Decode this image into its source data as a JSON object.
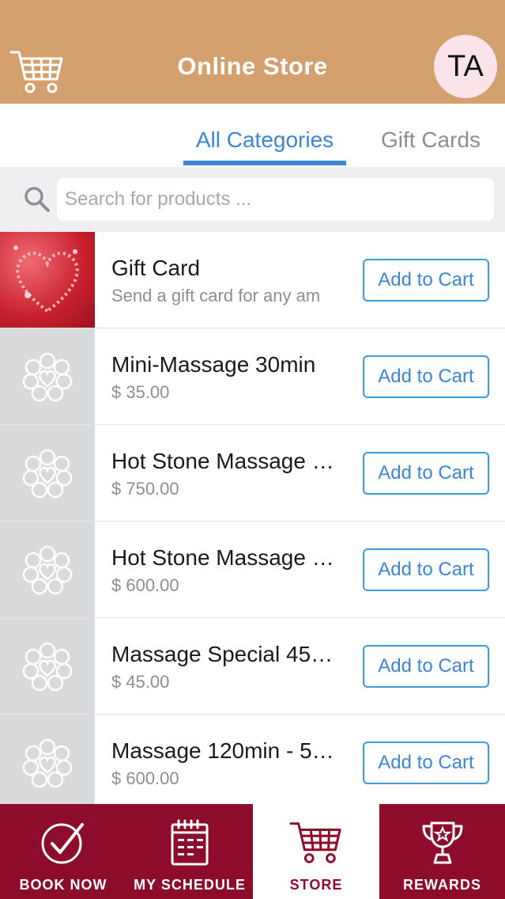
{
  "header": {
    "title": "Online Store",
    "avatar_initials": "TA",
    "left_icon": "cart-icon"
  },
  "tabs": [
    {
      "label": "All Categories",
      "active": true
    },
    {
      "label": "Gift Cards",
      "active": false
    }
  ],
  "search": {
    "placeholder": "Search for products ...",
    "value": ""
  },
  "products": [
    {
      "title": "Gift Card",
      "subtitle": "Send a gift card for any am",
      "button": "Add to Cart",
      "image": "gift-card-heart-image"
    },
    {
      "title": "Mini-Massage 30min",
      "subtitle": "$ 35.00",
      "button": "Add to Cart",
      "image": "spa-placeholder-icon"
    },
    {
      "title": "Hot Stone Massage …",
      "subtitle": "$ 750.00",
      "button": "Add to Cart",
      "image": "spa-placeholder-icon"
    },
    {
      "title": "Hot Stone Massage …",
      "subtitle": "$ 600.00",
      "button": "Add to Cart",
      "image": "spa-placeholder-icon"
    },
    {
      "title": "Massage Special 45…",
      "subtitle": "$ 45.00",
      "button": "Add to Cart",
      "image": "spa-placeholder-icon"
    },
    {
      "title": "Massage 120min - 5…",
      "subtitle": "$ 600.00",
      "button": "Add to Cart",
      "image": "spa-placeholder-icon"
    }
  ],
  "bottom_nav": [
    {
      "label": "BOOK NOW",
      "icon": "check-circle-icon",
      "active": false
    },
    {
      "label": "MY SCHEDULE",
      "icon": "calendar-icon",
      "active": false
    },
    {
      "label": "STORE",
      "icon": "cart-icon",
      "active": true
    },
    {
      "label": "REWARDS",
      "icon": "trophy-icon",
      "active": false
    }
  ],
  "colors": {
    "header_bg": "#d4a06e",
    "accent_blue": "#3c86d6",
    "nav_bg": "#8d0b2b",
    "avatar_bg": "#fbe3ea"
  }
}
